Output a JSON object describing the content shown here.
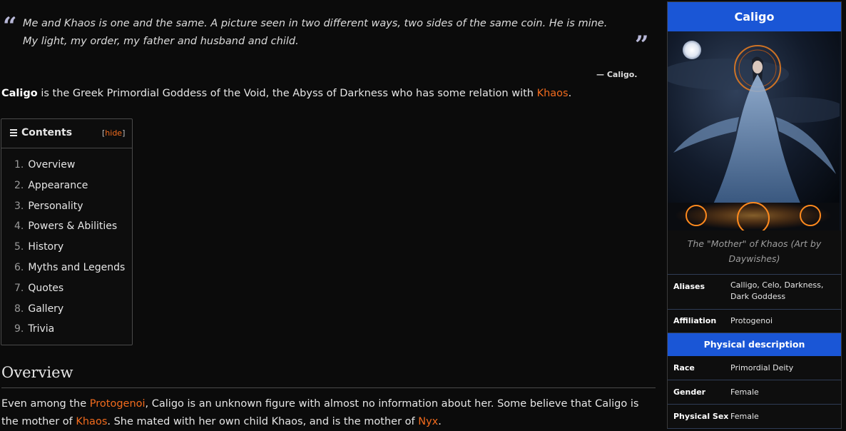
{
  "quote": {
    "text": "Me and Khaos is one and the same. A picture seen in two different ways, two sides of the same coin. He is mine. My light, my order, my father and husband and child.",
    "attribution": "— Caligo.",
    "open_mark": "“",
    "close_mark": "”"
  },
  "intro": {
    "bold": "Caligo",
    "text": " is the Greek Primordial Goddess of the Void, the Abyss of Darkness who has some relation with ",
    "link": "Khaos",
    "end": "."
  },
  "toc": {
    "title": "Contents",
    "toggle_open": "[",
    "toggle": "hide",
    "toggle_close": "]",
    "items": [
      {
        "num": "1.",
        "label": "Overview"
      },
      {
        "num": "2.",
        "label": "Appearance"
      },
      {
        "num": "3.",
        "label": "Personality"
      },
      {
        "num": "4.",
        "label": "Powers & Abilities"
      },
      {
        "num": "5.",
        "label": "History"
      },
      {
        "num": "6.",
        "label": "Myths and Legends"
      },
      {
        "num": "7.",
        "label": "Quotes"
      },
      {
        "num": "8.",
        "label": "Gallery"
      },
      {
        "num": "9.",
        "label": "Trivia"
      }
    ]
  },
  "overview": {
    "heading": "Overview",
    "p1": "Even among the ",
    "link1": "Protogenoi",
    "p2": ", Caligo is an unknown figure with almost no information about her. Some believe that Caligo is the mother of ",
    "link2": "Khaos",
    "p3": ". She mated with her own child Khaos, and is the mother of ",
    "link3": "Nyx",
    "p4": "."
  },
  "infobox": {
    "title": "Caligo",
    "caption": "The \"Mother\" of Khaos (Art by Daywishes)",
    "aliases_label": "Aliases",
    "aliases_value": "Calligo, Celo, Darkness, Dark Goddess",
    "affiliation_label": "Affiliation",
    "affiliation_value": "Protogenoi",
    "physical_header": "Physical description",
    "race_label": "Race",
    "race_value": "Primordial Deity",
    "gender_label": "Gender",
    "gender_value": "Female",
    "physsex_label": "Physical Sex",
    "physsex_value": "Female"
  },
  "colors": {
    "accent_link": "#f26b1d",
    "infobox_header": "#1a56d6",
    "background": "#0b0b0b"
  }
}
